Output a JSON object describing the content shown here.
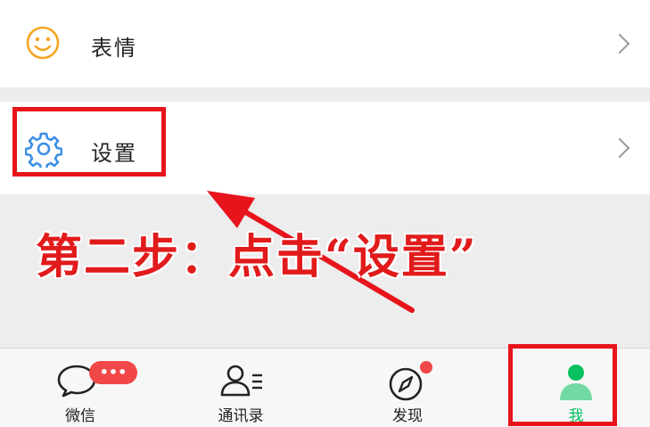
{
  "menu": {
    "sticker": {
      "label": "表情",
      "icon": "smiley-icon"
    },
    "settings": {
      "label": "设置",
      "icon": "gear-icon"
    }
  },
  "annotation": {
    "text": "第二步：点击“设置”",
    "color": "#e11b1b",
    "arrow": "arrow-pointing-to-settings"
  },
  "tabbar": {
    "tabs": [
      {
        "label": "微信",
        "icon": "chat-bubble-icon",
        "badge": "•••"
      },
      {
        "label": "通讯录",
        "icon": "contacts-icon"
      },
      {
        "label": "发现",
        "icon": "compass-icon",
        "dot": true
      },
      {
        "label": "我",
        "icon": "person-icon",
        "active": true
      }
    ]
  },
  "colors": {
    "accent": "#07c160",
    "highlight": "#e8141c",
    "badge": "#f04848"
  }
}
